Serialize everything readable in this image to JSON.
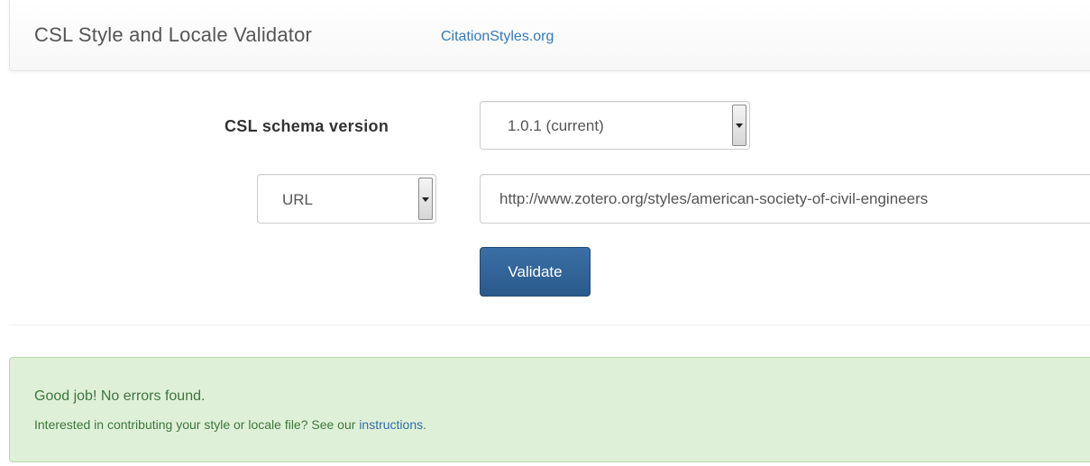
{
  "navbar": {
    "brand": "CSL Style and Locale Validator",
    "link": "CitationStyles.org"
  },
  "form": {
    "schema_label": "CSL schema version",
    "schema_value": "1.0.1 (current)",
    "source_value": "URL",
    "url_value": "http://www.zotero.org/styles/american-society-of-civil-engineers",
    "validate_label": "Validate"
  },
  "result": {
    "title": "Good job! No errors found.",
    "text_before": "Interested in contributing your style or locale file? See our ",
    "link": "instructions",
    "text_after": "."
  },
  "colors": {
    "link": "#337ab7",
    "primary_button": "#2d5f92",
    "success_bg": "#dff0d8",
    "success_text": "#3c763d"
  },
  "icons": {
    "dropdown": "chevron-down-icon"
  }
}
